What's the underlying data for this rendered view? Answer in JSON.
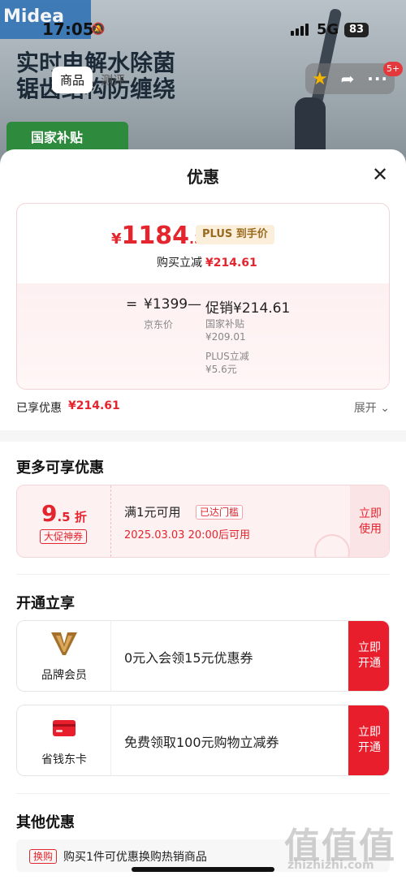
{
  "background": {
    "brand": "Midea",
    "headline": "实时电解水除菌 锯齿结构防缠绕",
    "subsidy_banner": "国家补贴"
  },
  "status_bar": {
    "time": "17:05",
    "network": "5G",
    "battery": "83"
  },
  "nav": {
    "tabs": [
      "商品",
      "测评"
    ],
    "badge": "5+"
  },
  "sheet": {
    "title": "优惠",
    "price": {
      "currency": "¥",
      "integer": "1184",
      "decimal": ".39",
      "tag": "PLUS 到手价",
      "instant_cut_label": "购买立减",
      "instant_cut_amount": "¥214.61",
      "eq": "=",
      "jd_price": "¥1399",
      "minus": "—",
      "promo": "促销¥214.61",
      "jd_price_label": "京东价",
      "sub_items": [
        {
          "label": "国家补贴",
          "amount": "¥209.01"
        },
        {
          "label": "PLUS立减",
          "amount": "¥5.6元"
        }
      ]
    },
    "enjoyed": {
      "label": "已享优惠",
      "amount": "¥214.61",
      "expand": "展开 ⌄"
    },
    "more_section": {
      "title": "更多可享优惠",
      "coupon": {
        "discount_big": "9",
        "discount_small": ".5 折",
        "tag": "大促神券",
        "condition": "满1元可用",
        "reached": "已达门槛",
        "time": "2025.03.03 20:00后可用",
        "button": "立即\n使用"
      }
    },
    "open_section": {
      "title": "开通立享",
      "cards": [
        {
          "name": "品牌会员",
          "desc": "0元入会领15元优惠券",
          "button": "立即\n开通",
          "icon": "brand-member-icon"
        },
        {
          "name": "省钱东卡",
          "desc": "免费领取100元购物立减券",
          "button": "立即\n开通",
          "icon": "card-icon"
        }
      ]
    },
    "other_section": {
      "title": "其他优惠",
      "tag": "换购",
      "text": "购买1件可优惠换购热销商品"
    }
  },
  "watermark": {
    "glyphs": "值值值",
    "site": "zhizhizhi.com"
  },
  "colors": {
    "accent_red": "#e4252e",
    "button_red": "#e81e2c",
    "plus_gold": "#9a6a1f"
  }
}
